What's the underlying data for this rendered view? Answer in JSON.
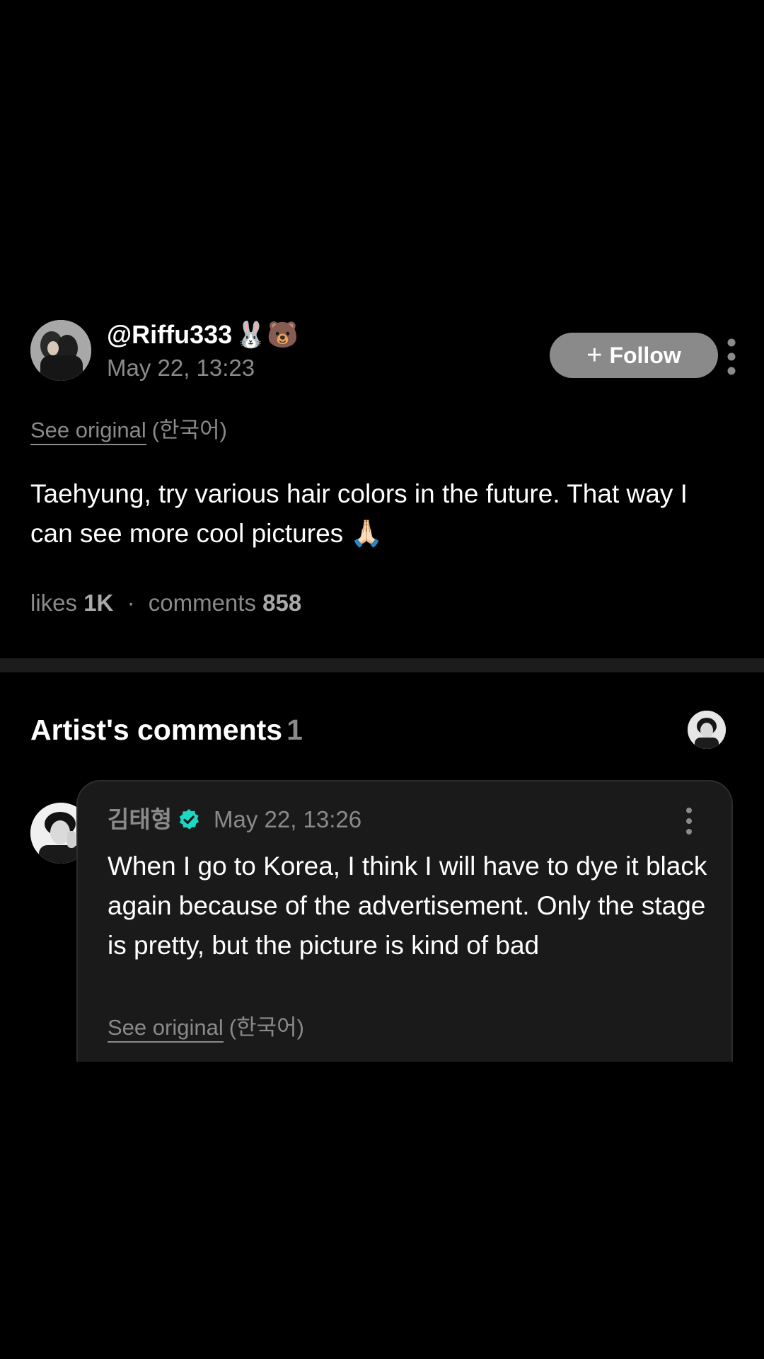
{
  "post": {
    "username": "@Riffu333",
    "username_emoji": "🐰🐻",
    "timestamp": "May 22, 13:23",
    "follow_label": "Follow",
    "follow_plus": "+",
    "see_original_label": "See original",
    "see_original_lang": "(한국어)",
    "body": "Taehyung, try various hair colors in the future. That way I can see more cool pictures 🙏🏻",
    "stats": {
      "likes_label": "likes",
      "likes_value": "1K",
      "separator": "·",
      "comments_label": "comments",
      "comments_value": "858"
    }
  },
  "artist_comments": {
    "title": "Artist's comments",
    "count": "1",
    "comment": {
      "author": "김태형",
      "timestamp": "May 22, 13:26",
      "text": "When I go to Korea, I think I will have to dye it black again because of the advertisement. Only the stage is pretty, but the picture is kind of bad",
      "see_original_label": "See original",
      "see_original_lang": "(한국어)"
    }
  },
  "icons": {
    "more": "more-vertical-icon",
    "verified": "verified-badge-icon",
    "verified_color": "#1ed7c3"
  },
  "colors": {
    "background": "#000000",
    "secondary_text": "#8a8a8a",
    "card_background": "#1a1a1a",
    "divider": "#1c1c1c",
    "follow_button": "#8a8a8a"
  }
}
